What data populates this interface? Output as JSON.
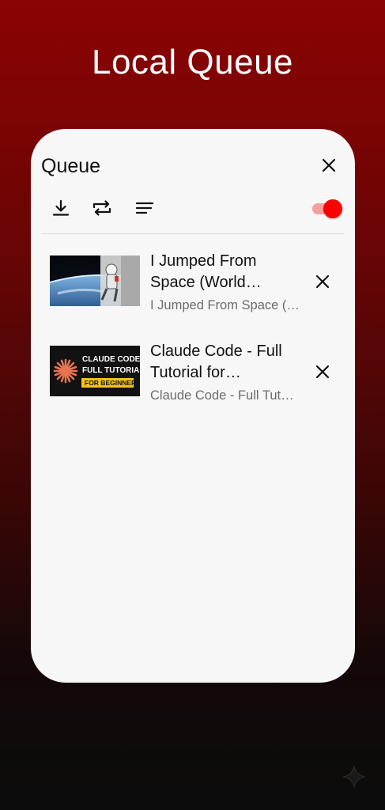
{
  "page": {
    "heading": "Local Queue"
  },
  "panel": {
    "title": "Queue",
    "close_icon": "close-icon",
    "toolbar": {
      "download_icon": "download-icon",
      "repeat_icon": "repeat-icon",
      "sort_icon": "sort-lines-icon",
      "toggle_state": "on",
      "toggle_color": "#ff0000"
    }
  },
  "queue": {
    "items": [
      {
        "title": "I Jumped From Space (World Record Supersonic Freefall)",
        "subtitle": "I Jumped From Space (World Record Supersonic Freefall)",
        "thumbnail": "space-jump-thumbnail"
      },
      {
        "title": "Claude Code - Full Tutorial for Beginners",
        "subtitle": "Claude Code - Full Tutorial for Beginners",
        "thumbnail": "claude-code-thumbnail",
        "thumbnail_text": [
          "CLAUDE CODE",
          "FULL TUTORIAL",
          "FOR BEGINNERS"
        ]
      }
    ]
  },
  "decor": {
    "sparkle_icon": "sparkle-icon"
  }
}
